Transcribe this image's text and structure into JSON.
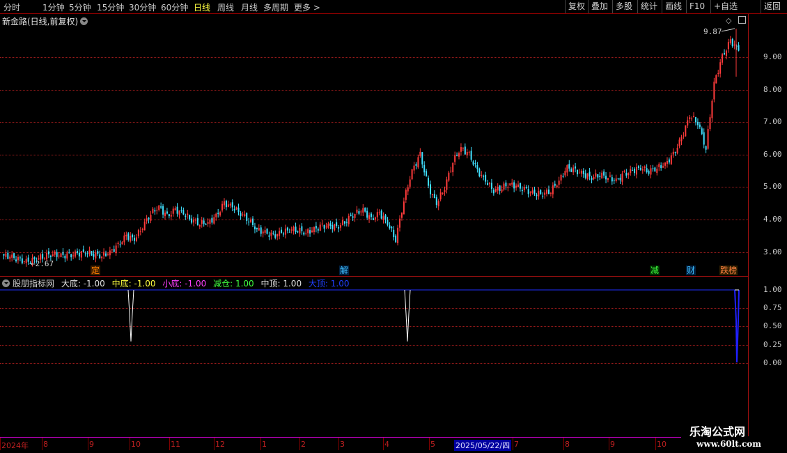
{
  "toolbar": {
    "periods": [
      "分时",
      "1分钟",
      "5分钟",
      "15分钟",
      "30分钟",
      "60分钟",
      "日线",
      "周线",
      "月线",
      "多周期",
      "更多 >"
    ],
    "active_period": "日线",
    "right_buttons": [
      "复权",
      "叠加",
      "多股",
      "统计",
      "画线",
      "F10",
      "+自选",
      "返回"
    ]
  },
  "stock": {
    "title": "新金路(日线,前复权)"
  },
  "colors": {
    "up": "#ff3b3b",
    "down": "#40e0ff",
    "grid": "#9b1b1b",
    "axis": "#a01010",
    "indicator_white": "#ffffff",
    "indicator_blue": "#2020ff"
  },
  "icons": [
    "diamond-icon",
    "window-toggle-icon"
  ],
  "price_axis": {
    "labels": [
      "9.00",
      "8.00",
      "7.00",
      "6.00",
      "5.00",
      "4.00",
      "3.00"
    ]
  },
  "annotations": {
    "high": "9.87",
    "low": "2.67"
  },
  "events": [
    {
      "label": "定",
      "color": "#ff8000",
      "bg": "#402000"
    },
    {
      "label": "解",
      "color": "#40c0ff",
      "bg": "#002040"
    },
    {
      "label": "减",
      "color": "#40ff40",
      "bg": "#003000"
    },
    {
      "label": "财",
      "color": "#40c0ff",
      "bg": "#002040"
    },
    {
      "label": "跌榜",
      "color": "#ff8040",
      "bg": "#302000"
    }
  ],
  "indicator": {
    "name": "股朋指标网",
    "legend": [
      {
        "text": "大底: -1.00",
        "color": "#e0e0e0"
      },
      {
        "text": "中底: -1.00",
        "color": "#ffff40"
      },
      {
        "text": "小底: -1.00",
        "color": "#ff40ff"
      },
      {
        "text": "减仓: 1.00",
        "color": "#40ff40"
      },
      {
        "text": "中顶: 1.00",
        "color": "#e0e0e0"
      },
      {
        "text": "大顶: 1.00",
        "color": "#2040ff"
      }
    ],
    "axis_labels": [
      "1.00",
      "0.75",
      "0.50",
      "0.25",
      "0.00"
    ]
  },
  "date_axis": {
    "labels": [
      "2024年",
      "8",
      "9",
      "10",
      "11",
      "12",
      "1",
      "2",
      "3",
      "4",
      "5",
      "7",
      "8",
      "9",
      "10"
    ],
    "highlight": "2025/05/22/四"
  },
  "brand": {
    "name": "乐淘公式网",
    "url": "www.60lt.com"
  },
  "chart_data": {
    "type": "candlestick",
    "title": "新金路(日线,前复权)",
    "y_range": [
      2.4,
      10.2
    ],
    "x_range": [
      "2024-07",
      "2025-10"
    ],
    "price_extremes": {
      "max": 9.87,
      "min": 2.67
    },
    "closes_approx": [
      2.9,
      2.85,
      2.75,
      2.7,
      2.8,
      2.9,
      2.95,
      2.9,
      2.9,
      2.95,
      3.0,
      2.95,
      2.9,
      3.0,
      3.2,
      3.5,
      3.4,
      3.8,
      4.2,
      4.4,
      4.1,
      4.3,
      4.2,
      4.0,
      3.9,
      3.9,
      4.1,
      4.5,
      4.4,
      4.2,
      4.0,
      3.7,
      3.6,
      3.5,
      3.6,
      3.7,
      3.7,
      3.6,
      3.7,
      3.8,
      3.8,
      3.8,
      4.0,
      4.2,
      4.3,
      4.0,
      4.2,
      3.9,
      3.4,
      4.6,
      5.5,
      6.0,
      5.0,
      4.5,
      5.0,
      5.8,
      6.2,
      6.0,
      5.5,
      5.2,
      4.9,
      5.0,
      5.1,
      5.0,
      4.9,
      4.8,
      4.8,
      4.9,
      5.2,
      5.6,
      5.5,
      5.4,
      5.3,
      5.4,
      5.3,
      5.2,
      5.4,
      5.5,
      5.6,
      5.5,
      5.6,
      5.7,
      6.0,
      6.5,
      7.2,
      7.0,
      6.2,
      8.2,
      9.0,
      9.5,
      9.2
    ],
    "indicator_series": {
      "name": "股朋指标网",
      "levels": [
        1.0,
        0.75,
        0.5,
        0.25,
        0.0
      ],
      "signals": [
        {
          "date": "2024-10",
          "color": "white",
          "min": 0.3
        },
        {
          "date": "2025-04",
          "color": "white",
          "min": 0.3
        },
        {
          "date": "2025-10",
          "color": "blue",
          "min": 0.0
        }
      ]
    }
  }
}
